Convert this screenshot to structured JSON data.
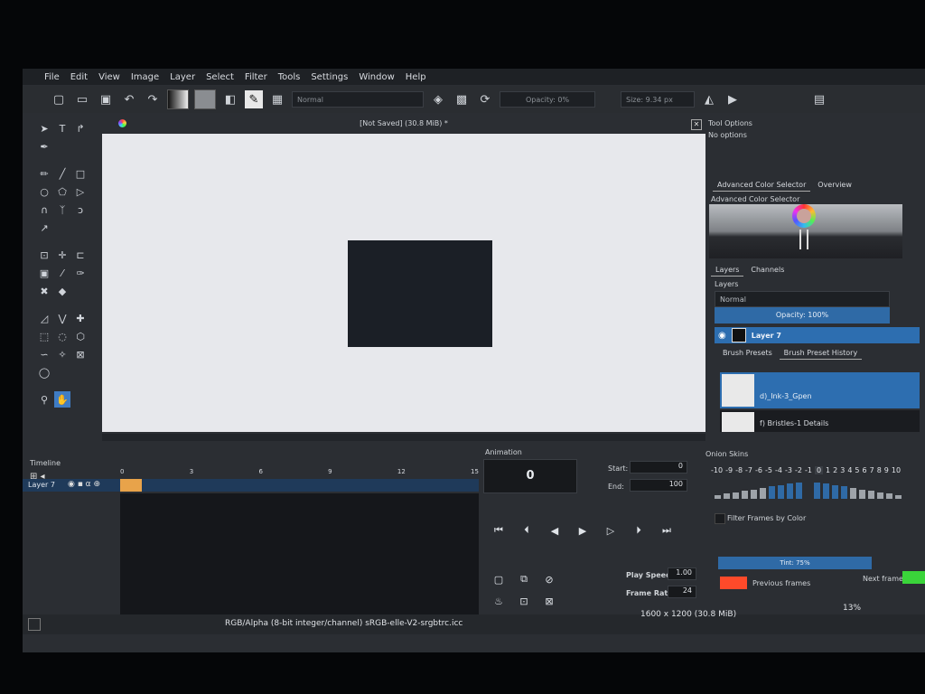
{
  "menu": [
    "File",
    "Edit",
    "View",
    "Image",
    "Layer",
    "Select",
    "Filter",
    "Tools",
    "Settings",
    "Window",
    "Help"
  ],
  "toolbar": {
    "blend_mode": "Normal",
    "opacity": "Opacity: 0%",
    "size": "Size: 9.34 px"
  },
  "document": {
    "title": "[Not Saved]  (30.8 MiB) *"
  },
  "tool_options": {
    "title": "Tool Options",
    "text": "No options"
  },
  "color_selector": {
    "tabs": [
      "Advanced Color Selector",
      "Overview"
    ],
    "title": "Advanced Color Selector"
  },
  "layers": {
    "tabs": [
      "Layers",
      "Channels"
    ],
    "title": "Layers",
    "blend": "Normal",
    "opacity": "Opacity: 100%",
    "layer_name": "Layer 7"
  },
  "brush_presets": {
    "tabs": [
      "Brush Presets",
      "Brush Preset History"
    ],
    "items": [
      "d)_Ink-3_Gpen",
      "f) Bristles-1 Details"
    ]
  },
  "timeline": {
    "title": "Timeline",
    "layer": "Layer 7",
    "frames": [
      "0",
      "3",
      "6",
      "9",
      "12",
      "15"
    ]
  },
  "animation": {
    "title": "Animation",
    "frame": "0",
    "start_label": "Start:",
    "start": "0",
    "end_label": "End:",
    "end": "100",
    "play_speed_label": "Play Speed:",
    "play_speed": "1.00",
    "frame_rate_label": "Frame Rate:",
    "frame_rate": "24"
  },
  "onion_skins": {
    "title": "Onion Skins",
    "numbers": [
      "-10",
      "-9",
      "-8",
      "-7",
      "-6",
      "-5",
      "-4",
      "-3",
      "-2",
      "-1",
      "0",
      "1",
      "2",
      "3",
      "4",
      "5",
      "6",
      "7",
      "8",
      "9",
      "10"
    ],
    "filter": "Filter Frames by Color",
    "tint": "Tint: 75%",
    "previous": "Previous frames",
    "next": "Next frames",
    "prev_color": "#ff4a2a",
    "next_color": "#3ad43a"
  },
  "status": {
    "colorspace": "RGB/Alpha (8-bit integer/channel)  sRGB-elle-V2-srgbtrc.icc",
    "dimensions": "1600 x 1200 (30.8 MiB)",
    "zoom": "13%"
  }
}
